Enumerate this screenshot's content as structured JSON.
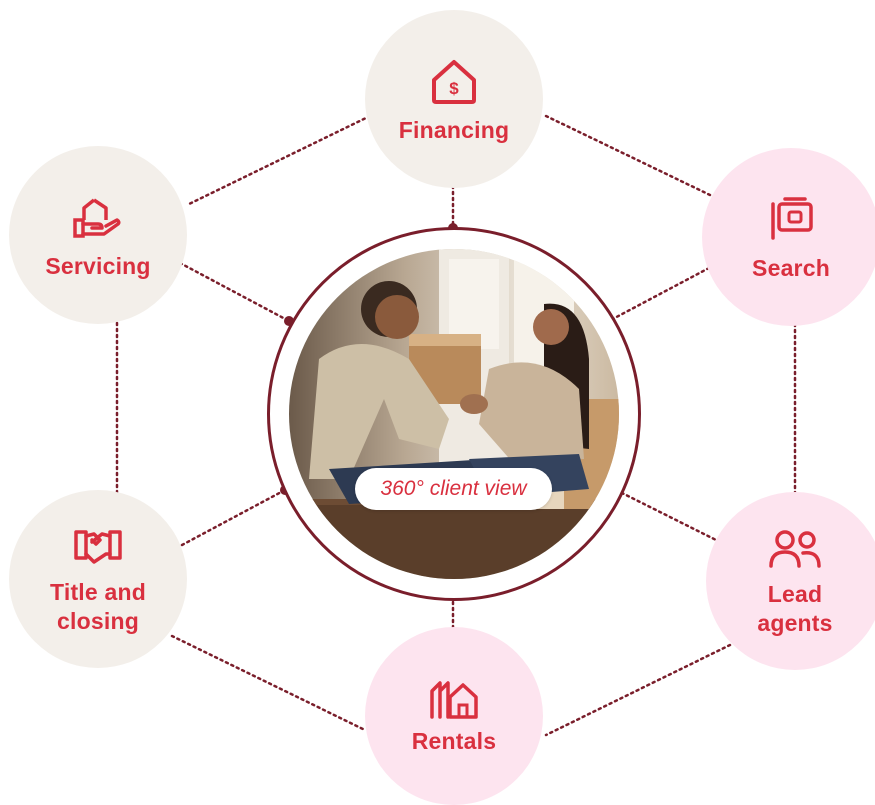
{
  "center": {
    "badge_text": "360° client view"
  },
  "nodes": {
    "financing": {
      "label": "Financing",
      "icon": "house-dollar-icon"
    },
    "servicing": {
      "label": "Servicing",
      "icon": "hand-house-icon"
    },
    "search": {
      "label": "Search",
      "icon": "listing-card-icon"
    },
    "title_closing": {
      "label_line1": "Title and",
      "label_line2": "closing",
      "icon": "handshake-icon"
    },
    "lead_agents": {
      "label_line1": "Lead",
      "label_line2": "agents",
      "icon": "people-icon"
    },
    "rentals": {
      "label": "Rentals",
      "icon": "houses-icon"
    }
  },
  "colors": {
    "accent_red": "#d9303f",
    "ring_maroon": "#7a1e2b",
    "node_beige": "#f3efea",
    "node_pink": "#fde4ef"
  }
}
